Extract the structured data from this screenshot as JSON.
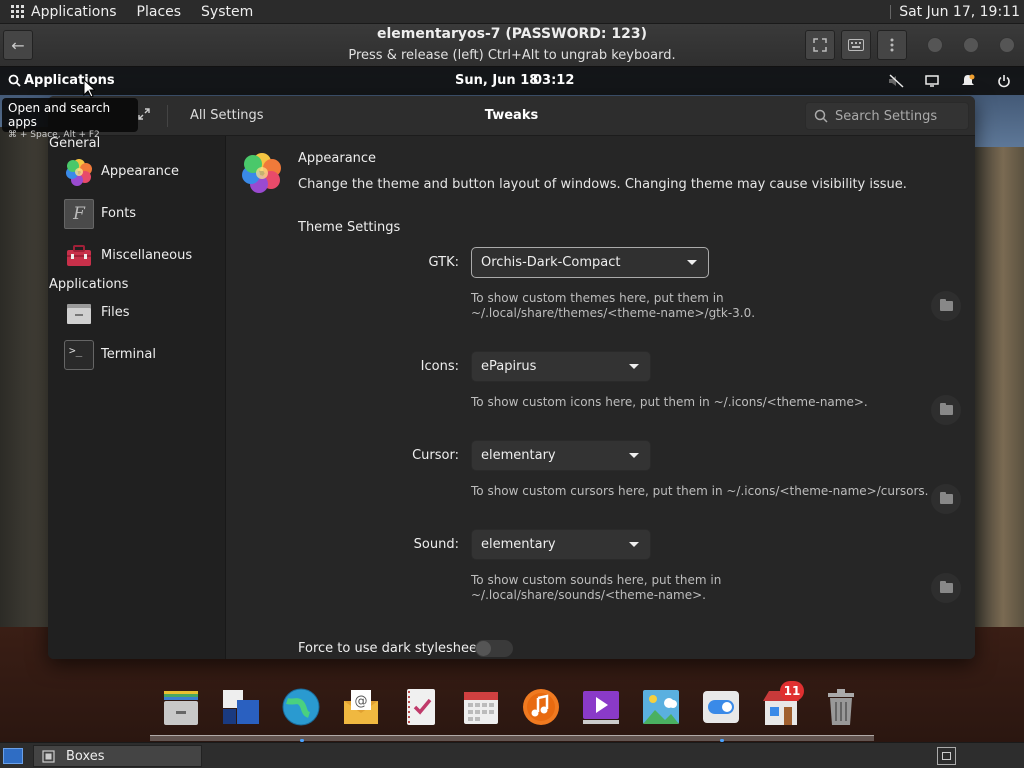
{
  "host_bar": {
    "menus": [
      "Applications",
      "Places",
      "System"
    ],
    "clock": "Sat Jun 17, 19:11"
  },
  "boxes": {
    "title": "elementaryos-7 (PASSWORD: 123)",
    "subtitle": "Press & release (left) Ctrl+Alt to ungrab keyboard."
  },
  "guest_panel": {
    "applications": "Applications",
    "date": "Sun, Jun 18",
    "time": "03:12"
  },
  "tooltip": {
    "title": "Open and search apps",
    "shortcut": "⌘ + Space, Alt + F2"
  },
  "settings": {
    "all_settings": "All Settings",
    "title": "Tweaks",
    "search_placeholder": "Search Settings",
    "sidebar": {
      "general_header": "General",
      "general_items": [
        {
          "label": "Appearance",
          "icon": "appearance-icon"
        },
        {
          "label": "Fonts",
          "icon": "fonts-icon"
        },
        {
          "label": "Miscellaneous",
          "icon": "miscellaneous-icon"
        }
      ],
      "applications_header": "Applications",
      "applications_items": [
        {
          "label": "Files",
          "icon": "files-icon"
        },
        {
          "label": "Terminal",
          "icon": "terminal-icon"
        }
      ]
    },
    "content": {
      "title": "Appearance",
      "description": "Change the theme and button layout of windows. Changing theme may cause visibility issue.",
      "section_title": "Theme Settings",
      "rows": [
        {
          "label": "GTK:",
          "value": "Orchis-Dark-Compact",
          "hint": "To show custom themes here, put them in ~/.local/share/themes/<theme-name>/gtk-3.0."
        },
        {
          "label": "Icons:",
          "value": "ePapirus",
          "hint": "To show custom icons here, put them in ~/.icons/<theme-name>."
        },
        {
          "label": "Cursor:",
          "value": "elementary",
          "hint": "To show custom cursors here, put them in ~/.icons/<theme-name>/cursors."
        },
        {
          "label": "Sound:",
          "value": "elementary",
          "hint": "To show custom sounds here, put them in ~/.local/share/sounds/<theme-name>."
        }
      ],
      "dark_stylesheet_label": "Force to use dark stylesheet:",
      "dark_stylesheet_on": false
    }
  },
  "dock": {
    "items": [
      "files-icon",
      "multitasking-icon",
      "web-browser-icon",
      "mail-icon",
      "tasks-icon",
      "calendar-icon",
      "music-icon",
      "videos-icon",
      "photos-icon",
      "system-settings-icon",
      "appcenter-icon",
      "trash-icon"
    ],
    "appcenter_badge": "11"
  },
  "taskbar": {
    "task_label": "Boxes"
  }
}
